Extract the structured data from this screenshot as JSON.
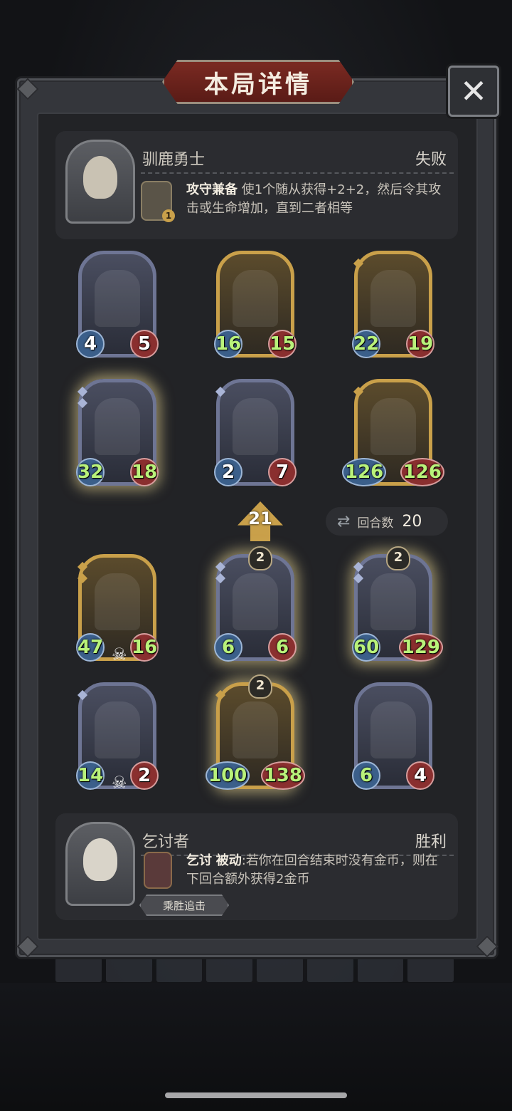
{
  "title": "本局详情",
  "close_glyph": "✕",
  "top_hero": {
    "name": "驯鹿勇士",
    "result": "失败",
    "skill_level": "1",
    "skill_name": "攻守兼备",
    "skill_desc": "使1个随从获得+2+2，然后令其攻击或生命增加，直到二者相等"
  },
  "enemy_units": [
    {
      "atk": "4",
      "hp": "5"
    },
    {
      "atk": "16",
      "hp": "15"
    },
    {
      "atk": "22",
      "hp": "19"
    },
    {
      "atk": "32",
      "hp": "18"
    },
    {
      "atk": "2",
      "hp": "7"
    },
    {
      "atk": "126",
      "hp": "126"
    }
  ],
  "arrow_value": "21",
  "round": {
    "label": "回合数",
    "value": "20"
  },
  "my_units": [
    {
      "atk": "47",
      "hp": "16"
    },
    {
      "atk": "6",
      "hp": "6",
      "tier": "2"
    },
    {
      "atk": "60",
      "hp": "129",
      "tier": "2"
    },
    {
      "atk": "14",
      "hp": "2"
    },
    {
      "atk": "100",
      "hp": "138",
      "tier": "2"
    },
    {
      "atk": "6",
      "hp": "4"
    }
  ],
  "bottom_hero": {
    "name": "乞讨者",
    "result": "胜利",
    "skill_name": "乞讨",
    "skill_type": "被动",
    "skill_desc": ":若你在回合结束时没有金币，则在下回合额外获得2金币",
    "tag": "乘胜追击"
  },
  "colors": {
    "gold_frame": "#c9a04a",
    "blue_frame": "#6e7594",
    "title_red": "#7a2a22",
    "buff_green": "#b9f27a"
  }
}
